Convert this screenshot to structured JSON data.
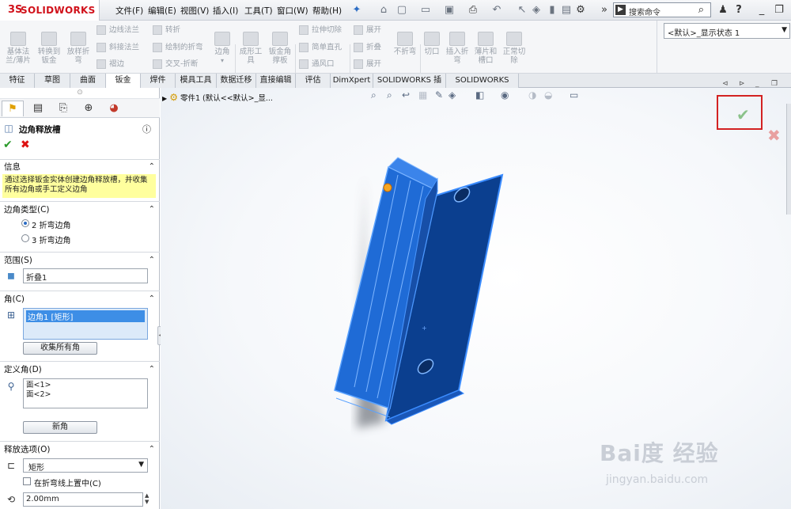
{
  "app": {
    "logo_ds": "3S",
    "logo_text": "SOLIDWORKS"
  },
  "menu": [
    "文件(F)",
    "编辑(E)",
    "视图(V)",
    "插入(I)",
    "工具(T)",
    "窗口(W)",
    "帮助(H)"
  ],
  "search": {
    "placeholder": "搜索命令"
  },
  "display_state": "<默认>_显示状态 1",
  "ribbon": {
    "large": [
      {
        "label": "基体法\n兰/薄片"
      },
      {
        "label": "转换到\n钣金"
      },
      {
        "label": "放样折\n弯"
      }
    ],
    "col1": [
      "边线法兰",
      "斜接法兰",
      "褶边"
    ],
    "col2": [
      "转折",
      "绘制的折弯",
      "交叉-折断"
    ],
    "corner": "边角",
    "forming": "成形工\n具",
    "gusset": "钣金角\n撑板",
    "col3": [
      "拉伸切除",
      "简单直孔",
      "通风口"
    ],
    "col4": [
      "展开",
      "折叠",
      "展开"
    ],
    "nofold": "不折弯",
    "cut": "切口",
    "insert_bend": "插入折\n弯",
    "tab_slot": "薄片和\n槽口",
    "normal_cut": "正常切\n除"
  },
  "tabs": [
    "特征",
    "草图",
    "曲面",
    "钣金",
    "焊件",
    "模具工具",
    "数据迁移",
    "直接编辑",
    "评估",
    "DimXpert",
    "SOLIDWORKS 插件",
    "SOLIDWORKS MBD"
  ],
  "active_tab": "钣金",
  "panel": {
    "title": "边角释放槽",
    "info_header": "信息",
    "info_text": "通过选择钣金实体创建边角释放槽，并收集所有边角或手工定义边角",
    "corner_type_header": "边角类型(C)",
    "radio_2": "2 折弯边角",
    "radio_3": "3 折弯边角",
    "scope_header": "范围(S)",
    "scope_value": "折叠1",
    "corner_header": "角(C)",
    "corner_item": "边角1 [矩形]",
    "collect_button": "收集所有角",
    "define_header": "定义角(D)",
    "faces": [
      "面<1>",
      "面<2>"
    ],
    "new_corner_button": "新角",
    "release_header": "释放选项(O)",
    "release_type": "矩形",
    "center_on_bend": "在折弯线上置中(C)",
    "size": "2.00mm"
  },
  "viewport": {
    "tree_label": "零件1 (默认<<默认>_显..."
  },
  "watermark": {
    "line1": "Bai度 经验",
    "line2": "jingyan.baidu.com"
  },
  "colors": {
    "part_blue": "#1f6bd6",
    "part_dark": "#0a3d8c",
    "ok_red": "#d32222",
    "info_yellow": "#ffff9e"
  }
}
